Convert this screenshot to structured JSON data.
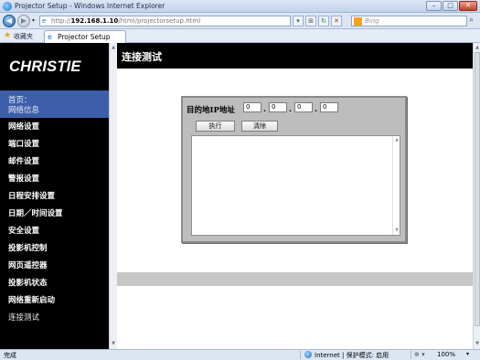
{
  "window": {
    "title": "Projector Setup - Windows Internet Explorer",
    "buttons": {
      "minimize": "–",
      "maximize": "□",
      "close": "✕"
    }
  },
  "address_bar": {
    "url_prefix": "http://",
    "url_host": "192.168.1.10",
    "url_path": "/html/projectorsetup.html",
    "search_placeholder": "Bing",
    "tools": [
      "▾",
      "⊞",
      "↻",
      "✕"
    ],
    "back_glyph": "◀",
    "forward_glyph": "▶",
    "search_glyph": "⌕"
  },
  "favorites_bar": {
    "favorites_label": "收藏夹",
    "tab_label": "Projector Setup"
  },
  "sidebar": {
    "logo_text": "CHRISTIE",
    "home_line1": "首页：",
    "home_line2": "网络信息",
    "items": [
      {
        "label": "网络设置"
      },
      {
        "label": "端口设置"
      },
      {
        "label": "邮件设置"
      },
      {
        "label": "警报设置"
      },
      {
        "label": "日程安排设置"
      },
      {
        "label": "日期／时间设置"
      },
      {
        "label": "安全设置"
      },
      {
        "label": "投影机控制"
      },
      {
        "label": "网页遥控器"
      },
      {
        "label": "投影机状态"
      },
      {
        "label": "网络重新启动"
      },
      {
        "label": "连接测试"
      }
    ],
    "active_item": "连接测试"
  },
  "main": {
    "page_title": "连接测试",
    "ip_label": "目的地IP地址",
    "ip_octets": [
      "0",
      "0",
      "0",
      "0"
    ],
    "execute_label": "执行",
    "clear_label": "清除",
    "result_text": ""
  },
  "status_bar": {
    "status": "完成",
    "zone": "Internet | 保护模式: 启用",
    "zoom": "100%",
    "zoom_control": "⊕ ▾"
  },
  "colors": {
    "sidebar_bg": "#000000",
    "home_item_bg": "#3d5ea8",
    "panel_bg": "#bdbdbd"
  }
}
